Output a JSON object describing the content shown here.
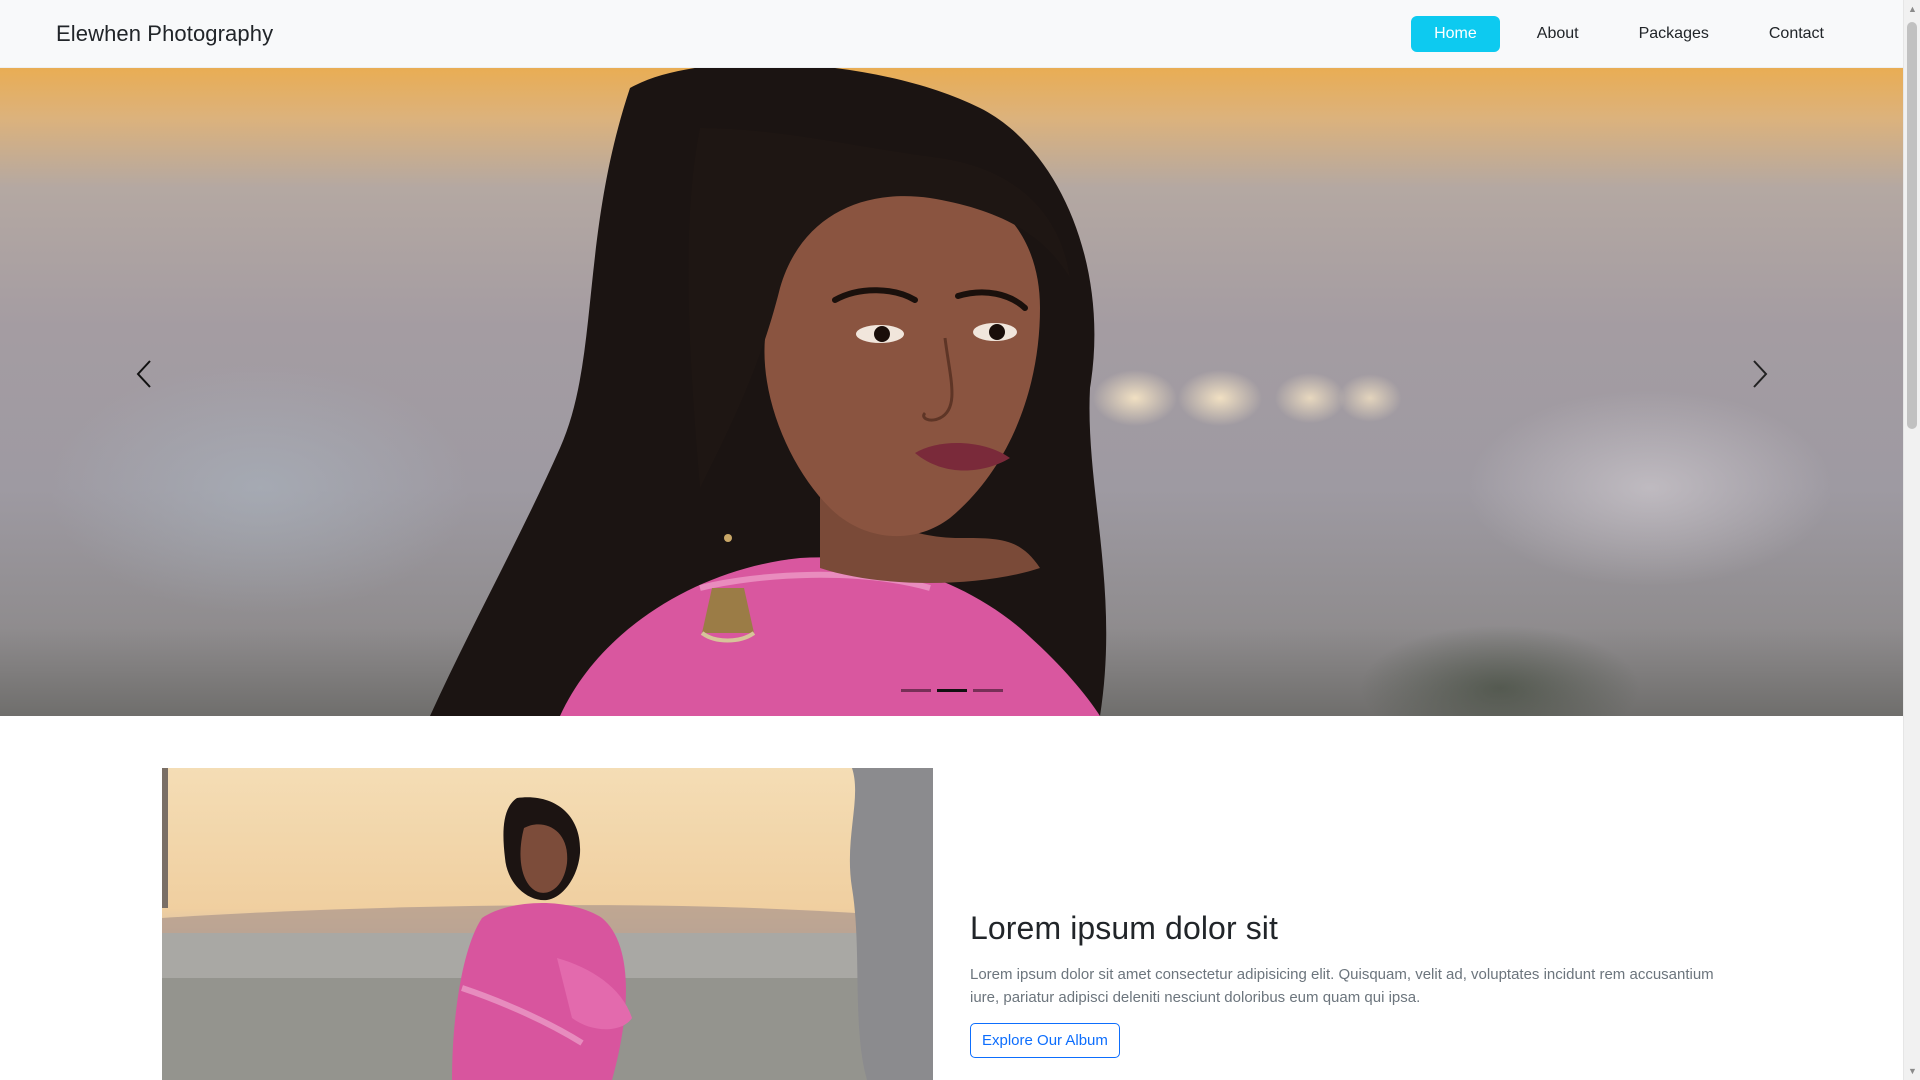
{
  "navbar": {
    "brand": "Elewhen Photography",
    "items": [
      {
        "label": "Home",
        "active": true
      },
      {
        "label": "About",
        "active": false
      },
      {
        "label": "Packages",
        "active": false
      },
      {
        "label": "Contact",
        "active": false
      }
    ],
    "accent": "#0dcaf0"
  },
  "carousel": {
    "slide_count": 3,
    "active_index": 1,
    "prev_icon": "chevron-left-icon",
    "next_icon": "chevron-right-icon"
  },
  "feature": {
    "title": "Lorem ipsum dolor sit",
    "body": "Lorem ipsum dolor sit amet consectetur adipisicing elit. Quisquam, velit ad, voluptates incidunt rem accusantium iure, pariatur adipisci deleniti nesciunt doloribus eum quam qui ipsa.",
    "button_label": "Explore Our Album",
    "button_color": "#0d6efd"
  }
}
